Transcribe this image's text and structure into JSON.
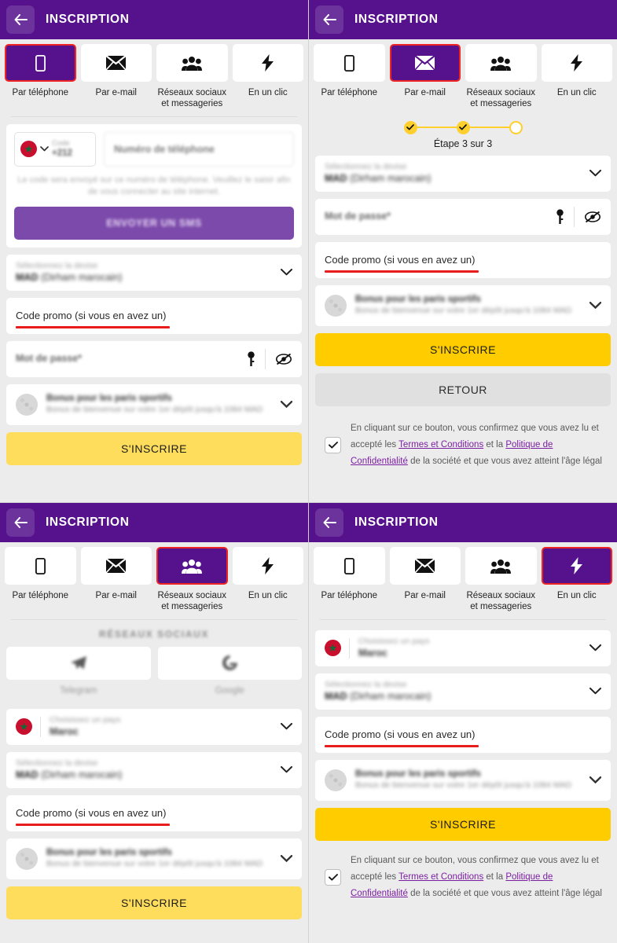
{
  "header": {
    "title": "INSCRIPTION",
    "back_icon": "arrow-left-icon"
  },
  "tabs": [
    {
      "label": "Par téléphone",
      "icon": "phone-icon"
    },
    {
      "label": "Par e-mail",
      "icon": "envelope-icon"
    },
    {
      "label": "Réseaux sociaux\net messageries",
      "icon": "people-group-icon"
    },
    {
      "label": "En un clic",
      "icon": "lightning-bolt-icon"
    }
  ],
  "phone_form": {
    "code_label": "Code",
    "code_value": "+212",
    "phone_placeholder": "Numéro de téléphone",
    "hint": "Le code sera envoyé sur ce numéro de téléphone. Veuillez le saisir afin de vous connecter au site internet.",
    "sms_button": "ENVOYER UN SMS",
    "flag_country": "Maroc"
  },
  "steps": {
    "label": "Étape 3 sur 3",
    "total": 3,
    "completed": 2
  },
  "currency_field": {
    "label": "Sélectionnez la devise",
    "value_code": "MAD",
    "value_name": "(Dirham marocain)"
  },
  "country_field": {
    "label": "Choisissez un pays",
    "value": "Maroc"
  },
  "password_field": {
    "placeholder": "Mot de passe*",
    "key_icon": "key-icon",
    "eye_icon": "eye-off-icon"
  },
  "promo_field": {
    "label": "Code promo (si vous en avez un)",
    "highlight_color": "#e81c1c"
  },
  "bonus_field": {
    "title": "Bonus pour les paris sportifs",
    "subtitle": "Bonus de bienvenue sur votre 1er dépôt jusqu'à 1084 MAD"
  },
  "buttons": {
    "signup": "S'INSCRIRE",
    "back": "RETOUR"
  },
  "consent": {
    "line1": "En cliquant sur ce bouton, vous confirmez que vous avez lu et",
    "line2_a": "accepté les ",
    "link1": "Termes et Conditions",
    "line2_b": " et la ",
    "link2": "Politique de Confidentialité",
    "line3": "de la société et que vous avez atteint l'âge légal"
  },
  "social": {
    "heading": "RÉSEAUX SOCIAUX",
    "items": [
      {
        "name": "Telegram",
        "icon": "telegram-icon"
      },
      {
        "name": "Google",
        "icon": "google-icon"
      }
    ]
  },
  "colors": {
    "header_purple": "#56128c",
    "accent_yellow": "#ffcc00",
    "highlight_red": "#e81c1c",
    "link_purple": "#7b1fa2"
  }
}
